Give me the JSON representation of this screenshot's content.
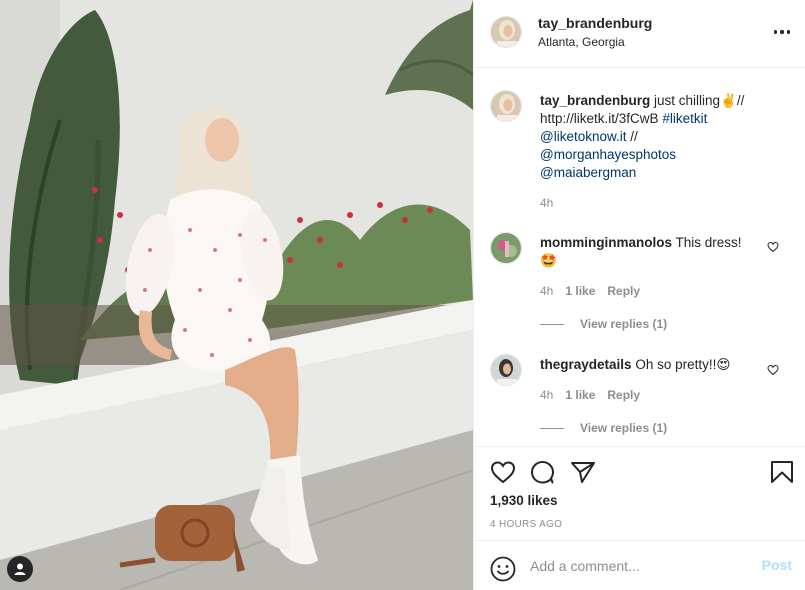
{
  "post": {
    "username": "tay_brandenburg",
    "location": "Atlanta, Georgia",
    "more_icon": "more-options-icon"
  },
  "caption": {
    "username": "tay_brandenburg",
    "text_before": " just chilling✌️//",
    "url": "http://liketk.it/3fCwB",
    "hashtag": "#liketkit",
    "mention_1": "@liketoknow.it",
    "separator": " //",
    "mention_2": "@morganhayesphotos",
    "mention_3": "@maiabergman",
    "time": "4h"
  },
  "comments": [
    {
      "username": "mommingin​manolos",
      "text": "This dress!",
      "emoji": "🤩",
      "time": "4h",
      "likes": "1 like",
      "reply": "Reply",
      "view_replies": "View replies (1)"
    },
    {
      "username": "thegraydetails",
      "text": "Oh so pretty!!",
      "emoji": "😍",
      "time": "4h",
      "likes": "1 like",
      "reply": "Reply",
      "view_replies": "View replies (1)"
    }
  ],
  "actions": {
    "like_icon": "heart-icon",
    "comment_icon": "comment-icon",
    "share_icon": "share-icon",
    "save_icon": "bookmark-icon",
    "likes_count": "1,930 likes",
    "posted_ago": "4 HOURS AGO"
  },
  "add_comment": {
    "placeholder": "Add a comment...",
    "post_label": "Post"
  },
  "colors": {
    "text": "#262626",
    "secondary": "#8e8e8e",
    "link": "#00376b",
    "post_disabled": "#b2dffc",
    "border": "#efefef"
  }
}
